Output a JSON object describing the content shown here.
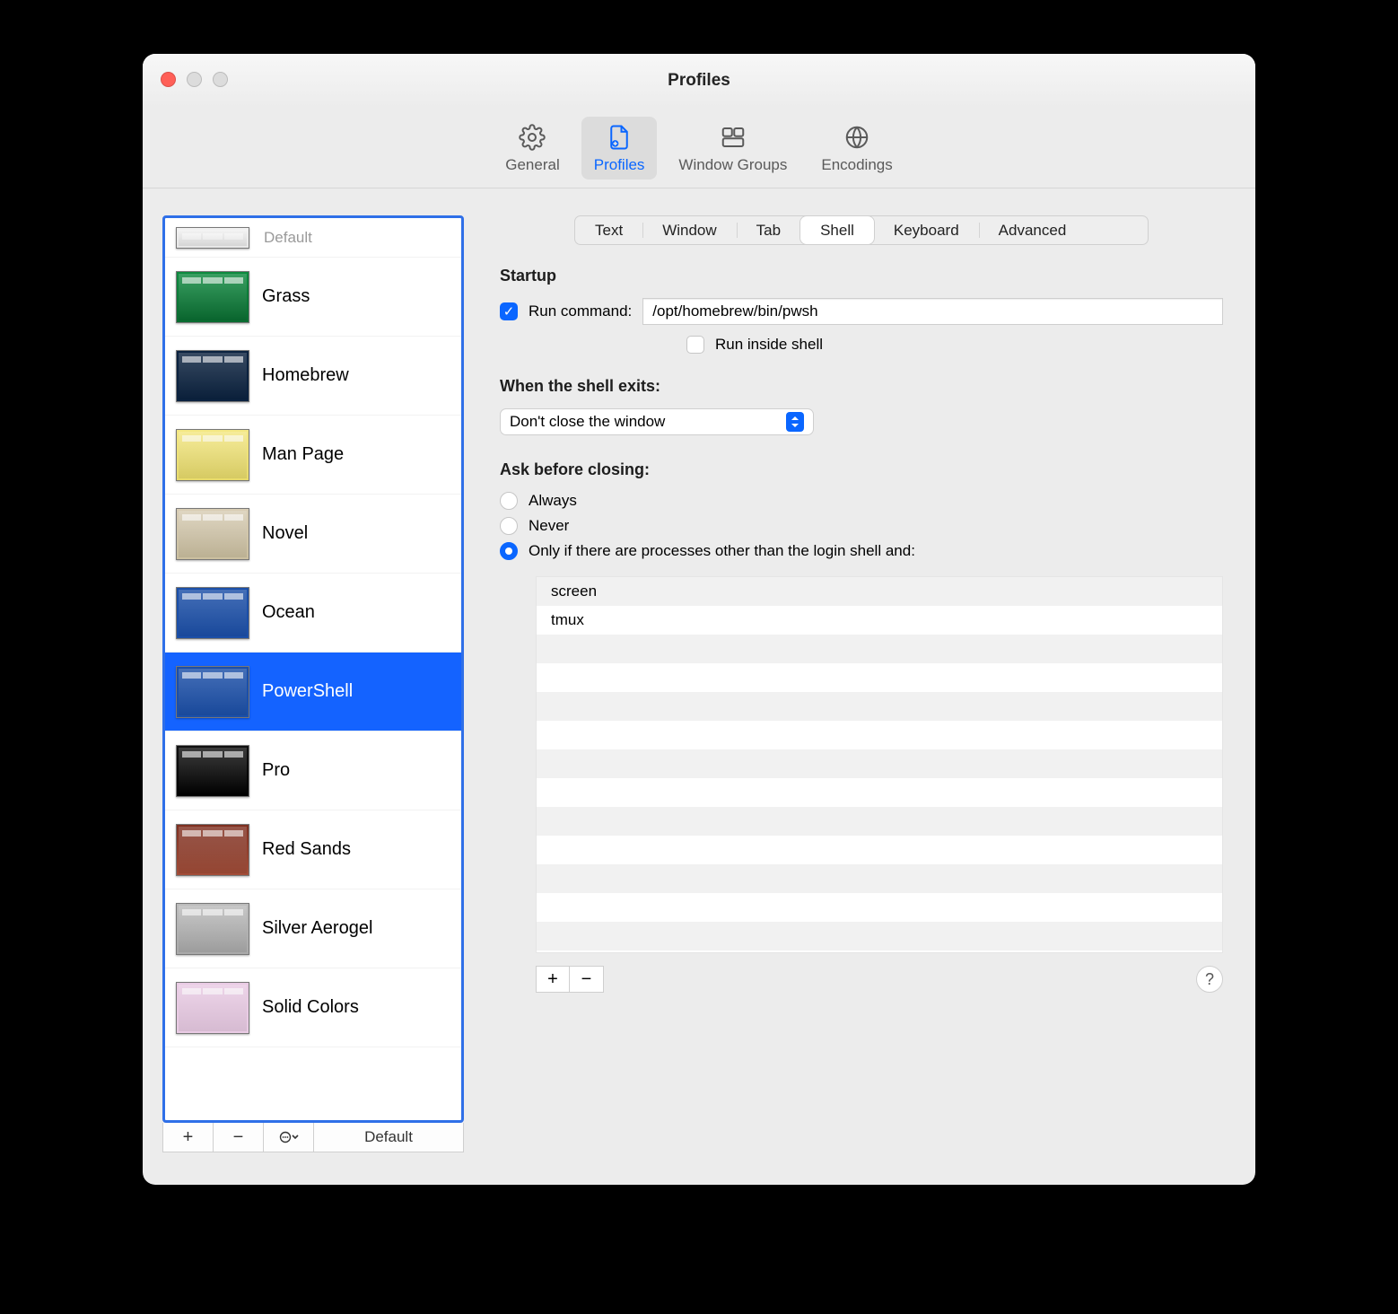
{
  "window": {
    "title": "Profiles"
  },
  "toolbar": {
    "items": [
      {
        "label": "General"
      },
      {
        "label": "Profiles"
      },
      {
        "label": "Window Groups"
      },
      {
        "label": "Encodings"
      }
    ],
    "selected": "Profiles"
  },
  "sidebar": {
    "default_badge": "Default",
    "profiles": [
      {
        "name": "",
        "colors": [
          "#f2f2f2",
          "#e7e7e7"
        ]
      },
      {
        "name": "Grass",
        "colors": [
          "#0d8a3f",
          "#0a6c31"
        ]
      },
      {
        "name": "Homebrew",
        "colors": [
          "#0b223f",
          "#0b223f"
        ]
      },
      {
        "name": "Man Page",
        "colors": [
          "#f4e884",
          "#e8db6a"
        ]
      },
      {
        "name": "Novel",
        "colors": [
          "#d8cdb5",
          "#cbbf9f"
        ]
      },
      {
        "name": "Ocean",
        "colors": [
          "#1b4fa8",
          "#1b4fa8"
        ]
      },
      {
        "name": "PowerShell",
        "colors": [
          "#1b4fa8",
          "#1b4fa8"
        ]
      },
      {
        "name": "Pro",
        "colors": [
          "#111",
          "#000"
        ]
      },
      {
        "name": "Red Sands",
        "colors": [
          "#7e2f20",
          "#a34d38"
        ]
      },
      {
        "name": "Silver Aerogel",
        "colors": [
          "#bcbcbc",
          "#a9a9a9"
        ]
      },
      {
        "name": "Solid Colors",
        "colors": [
          "#e9cbe4",
          "#e9cbe4"
        ]
      }
    ],
    "selected": "PowerShell",
    "footer": {
      "add": "+",
      "remove": "−",
      "menu": "⊙⌄",
      "default_btn": "Default"
    }
  },
  "tabs": {
    "items": [
      "Text",
      "Window",
      "Tab",
      "Shell",
      "Keyboard",
      "Advanced"
    ],
    "selected": "Shell"
  },
  "startup": {
    "heading": "Startup",
    "run_command_label": "Run command:",
    "run_command_checked": true,
    "command_value": "/opt/homebrew/bin/pwsh",
    "run_inside_shell_label": "Run inside shell",
    "run_inside_shell_checked": false
  },
  "shell_exit": {
    "heading": "When the shell exits:",
    "value": "Don't close the window"
  },
  "ask_close": {
    "heading": "Ask before closing:",
    "options": [
      {
        "label": "Always",
        "checked": false
      },
      {
        "label": "Never",
        "checked": false
      },
      {
        "label": "Only if there are processes other than the login shell and:",
        "checked": true
      }
    ],
    "processes": [
      "screen",
      "tmux"
    ]
  },
  "footer": {
    "add": "+",
    "remove": "−",
    "help": "?"
  }
}
